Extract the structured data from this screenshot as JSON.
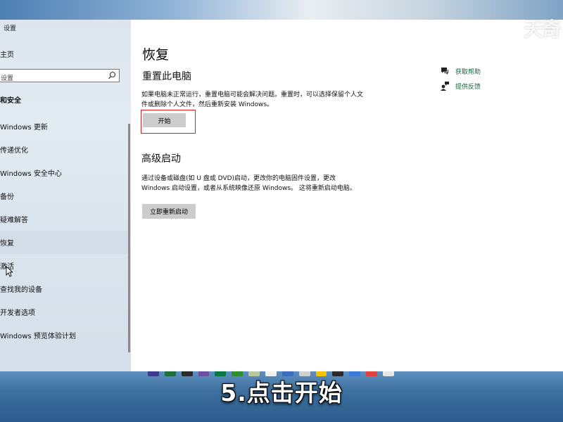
{
  "watermark": "天奇",
  "window": {
    "title": "设置",
    "minimize_glyph": "—",
    "close_glyph": "✕"
  },
  "sidebar": {
    "home": "主页",
    "search_placeholder": "设置",
    "section": "和安全",
    "items": [
      {
        "label": "Windows 更新"
      },
      {
        "label": "传递优化"
      },
      {
        "label": "Windows 安全中心"
      },
      {
        "label": "备份"
      },
      {
        "label": "疑难解答"
      },
      {
        "label": "恢复"
      },
      {
        "label": "激活"
      },
      {
        "label": "查找我的设备"
      },
      {
        "label": "开发者选项"
      },
      {
        "label": "Windows 预览体验计划"
      }
    ],
    "selected_index": 5
  },
  "main": {
    "page_title": "恢复",
    "reset": {
      "heading": "重置此电脑",
      "description": "如果电脑未正常运行，重置电脑可能会解决问题。重置时，可以选择保留个人文件或删除个人文件，然后重新安装 Windows。",
      "button": "开始"
    },
    "advanced": {
      "heading": "高级启动",
      "description": "通过设备或磁盘(如 U 盘或 DVD)启动，更改你的电脑固件设置，更改 Windows 启动设置，或者从系统映像还原 Windows。 这将重新启动电脑。",
      "button": "立即重新启动"
    },
    "links": {
      "help": "获取帮助",
      "feedback": "提供反馈"
    }
  },
  "caption": "5.点击开始",
  "colors": {
    "highlight": "#e02020",
    "link": "#0b6a3c",
    "button": "#cccccc",
    "accent": "#0063b1"
  },
  "taskbar_colors": [
    "#3b3b8f",
    "#1f6f3f",
    "#2b2b2b",
    "#6d4fa0",
    "#0a7a44",
    "#2f8f2f",
    "#b8c8a0",
    "#f0f0f0",
    "#3a6fbf",
    "#d0d0d0",
    "#f2c200",
    "#2a2a2a",
    "#3b78d8",
    "#e04040",
    "#e8e8e8"
  ]
}
